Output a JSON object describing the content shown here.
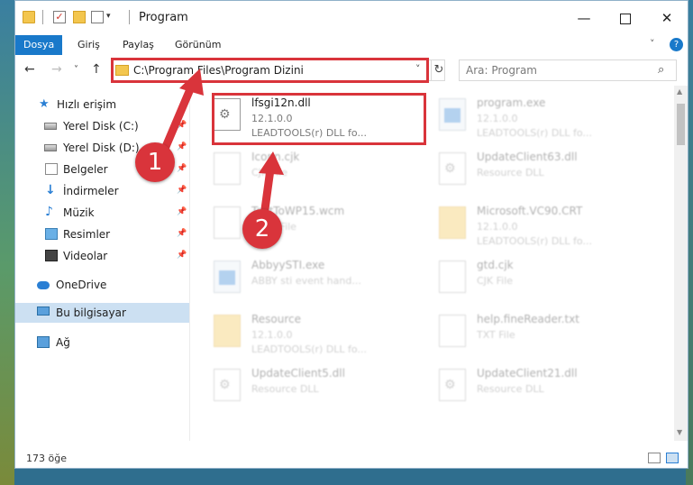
{
  "window": {
    "title": "Program"
  },
  "ribbon": {
    "tabs": [
      "Dosya",
      "Giriş",
      "Paylaş",
      "Görünüm"
    ],
    "active_tab": "Dosya",
    "help": "?"
  },
  "nav": {
    "back": "←",
    "forward": "→",
    "recent": "˅",
    "up": "↑"
  },
  "address": {
    "path": "C:\\Program Files\\Program Dizini",
    "dropdown": "˅",
    "refresh": "↻"
  },
  "search": {
    "placeholder": "Ara: Program",
    "icon": "search-icon"
  },
  "sidebar": {
    "items": [
      {
        "label": "Hızlı erişim",
        "icon": "star-icon"
      },
      {
        "label": "Yerel Disk (C:)",
        "icon": "drive-icon",
        "pinned": true
      },
      {
        "label": "Yerel Disk (D:)",
        "icon": "drive-icon",
        "pinned": true
      },
      {
        "label": "Belgeler",
        "icon": "document-icon",
        "pinned": true
      },
      {
        "label": "İndirmeler",
        "icon": "download-icon",
        "pinned": true
      },
      {
        "label": "Müzik",
        "icon": "music-icon",
        "pinned": true
      },
      {
        "label": "Resimler",
        "icon": "pictures-icon",
        "pinned": true
      },
      {
        "label": "Videolar",
        "icon": "videos-icon",
        "pinned": true
      },
      {
        "label": "OneDrive",
        "icon": "cloud-icon"
      },
      {
        "label": "Bu bilgisayar",
        "icon": "computer-icon",
        "selected": true
      },
      {
        "label": "Ağ",
        "icon": "network-icon"
      }
    ]
  },
  "files": [
    {
      "name": "lfsgi12n.dll",
      "line2": "12.1.0.0",
      "line3": "LEADTOOLS(r) DLL fo...",
      "icon": "dll",
      "highlighted": true
    },
    {
      "name": "program.exe",
      "line2": "12.1.0.0",
      "line3": "LEADTOOLS(r) DLL fo...",
      "icon": "exe"
    },
    {
      "name": "Iconn.cjk",
      "line2": "CJK File",
      "line3": "",
      "icon": "dll"
    },
    {
      "name": "UpdateClient63.dll",
      "line2": "Resource DLL",
      "line3": "",
      "icon": "dll"
    },
    {
      "name": "TextToWP15.wcm",
      "line2": "WCM File",
      "line3": "",
      "icon": "dll"
    },
    {
      "name": "Microsoft.VC90.CRT",
      "line2": "12.1.0.0",
      "line3": "LEADTOOLS(r) DLL fo...",
      "icon": "folder"
    },
    {
      "name": "AbbyySTI.exe",
      "line2": "ABBY sti event hand...",
      "line3": "",
      "icon": "exe"
    },
    {
      "name": "gtd.cjk",
      "line2": "CJK File",
      "line3": "",
      "icon": "dll"
    },
    {
      "name": "Resource",
      "line2": "12.1.0.0",
      "line3": "LEADTOOLS(r) DLL fo...",
      "icon": "folder"
    },
    {
      "name": "help.fineReader.txt",
      "line2": "TXT File",
      "line3": "",
      "icon": "dll"
    },
    {
      "name": "UpdateClient5.dll",
      "line2": "Resource DLL",
      "line3": "",
      "icon": "dll"
    },
    {
      "name": "UpdateClient21.dll",
      "line2": "Resource DLL",
      "line3": "",
      "icon": "dll"
    }
  ],
  "status": {
    "count": "173 öğe"
  },
  "annotations": {
    "step1": "1",
    "step2": "2",
    "color": "#d9343b"
  },
  "colors": {
    "accent": "#1979ca",
    "selection": "#cce0f2",
    "highlight": "#d9343b"
  }
}
